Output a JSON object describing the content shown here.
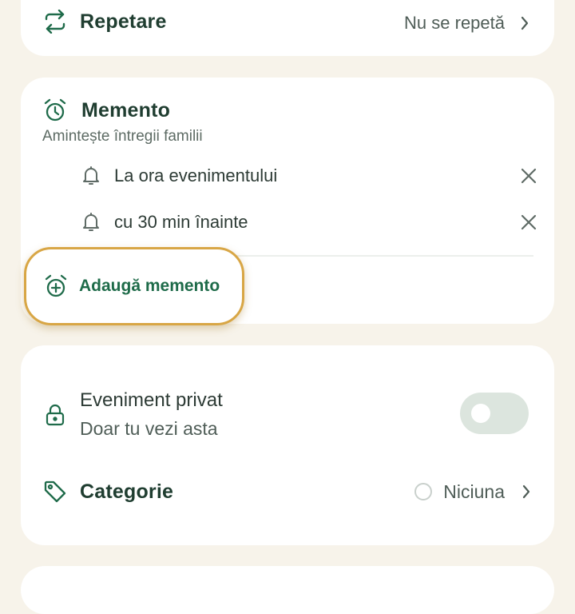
{
  "repeat": {
    "title": "Repetare",
    "value": "Nu se repetă",
    "icon": "repeat-icon"
  },
  "reminder": {
    "title": "Memento",
    "subtitle": "Amintește întregii familii",
    "items": [
      {
        "label": "La ora evenimentului"
      },
      {
        "label": "cu 30 min înainte"
      }
    ],
    "add_label": "Adaugă memento"
  },
  "private_event": {
    "title": "Eveniment privat",
    "subtitle": "Doar tu vezi asta",
    "enabled": false
  },
  "category": {
    "title": "Categorie",
    "value": "Niciuna"
  },
  "colors": {
    "accent": "#1f6b4a",
    "highlight": "#d8a645",
    "background": "#f7f3ea"
  }
}
